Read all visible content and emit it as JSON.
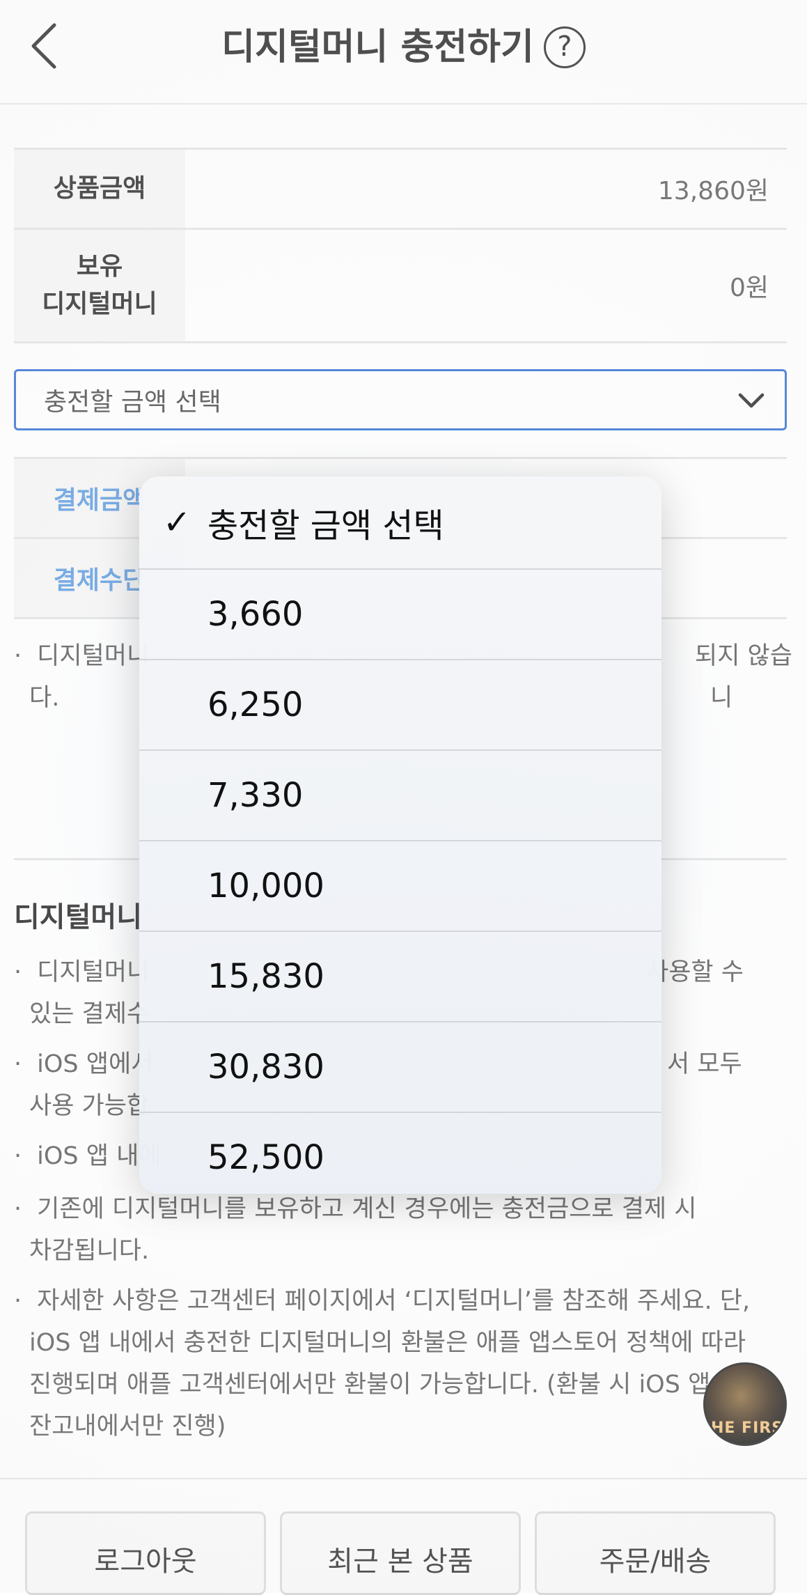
{
  "header": {
    "title": "디지털머니 충전하기",
    "help_icon": "question-circle-icon",
    "back_icon": "chevron-left-icon"
  },
  "info": {
    "price_label": "상품금액",
    "price_value": "13,860원",
    "balance_label_line1": "보유",
    "balance_label_line2": "디지털머니",
    "balance_value": "0원"
  },
  "select": {
    "value": "충전할 금액 선택",
    "chevron_icon": "chevron-down-icon"
  },
  "payment": {
    "amount_label": "결제금액",
    "method_label": "결제수단"
  },
  "notes_top": [
    {
      "left": "디지털머니",
      "right": "되지 않습니",
      "line2": "다."
    }
  ],
  "section": {
    "title": "디지털머니"
  },
  "notes": [
    {
      "line1_left": "디지털머니",
      "line1_right": "사용할 수",
      "line2": "있는 결제수"
    },
    {
      "line1_left": "iOS 앱에서",
      "line1_right": "서 모두",
      "line2": "사용 가능합"
    },
    {
      "line1_left": "iOS 앱 내에"
    },
    {
      "line1": "기존에 디지털머니를 보유하고 계신 경우에는 충전금으로 결제 시",
      "line2": "차감됩니다."
    },
    {
      "line1": "자세한 사항은 고객센터 페이지에서 ‘디지털머니’를 참조해 주세요. 단,",
      "line2": "iOS 앱 내에서 충전한 디지털머니의 환불은 애플 앱스토어 정책에 따라",
      "line3": "진행되며 애플 고객센터에서만 환불이 가능합니다. (환불 시 iOS 앱",
      "line4": "잔고내에서만 진행)"
    }
  ],
  "dropdown": {
    "selected_icon": "checkmark-icon",
    "options": [
      "충전할 금액 선택",
      "3,660",
      "6,250",
      "7,330",
      "10,000",
      "15,830",
      "30,830",
      "52,500"
    ]
  },
  "footer": {
    "logout": "로그아웃",
    "recent": "최근 본 상품",
    "orders": "주문/배송"
  },
  "floating": {
    "thumb_text": "HE FIRS"
  },
  "colors": {
    "accent": "#2d6bd2",
    "label_blue": "#5b9be0"
  }
}
